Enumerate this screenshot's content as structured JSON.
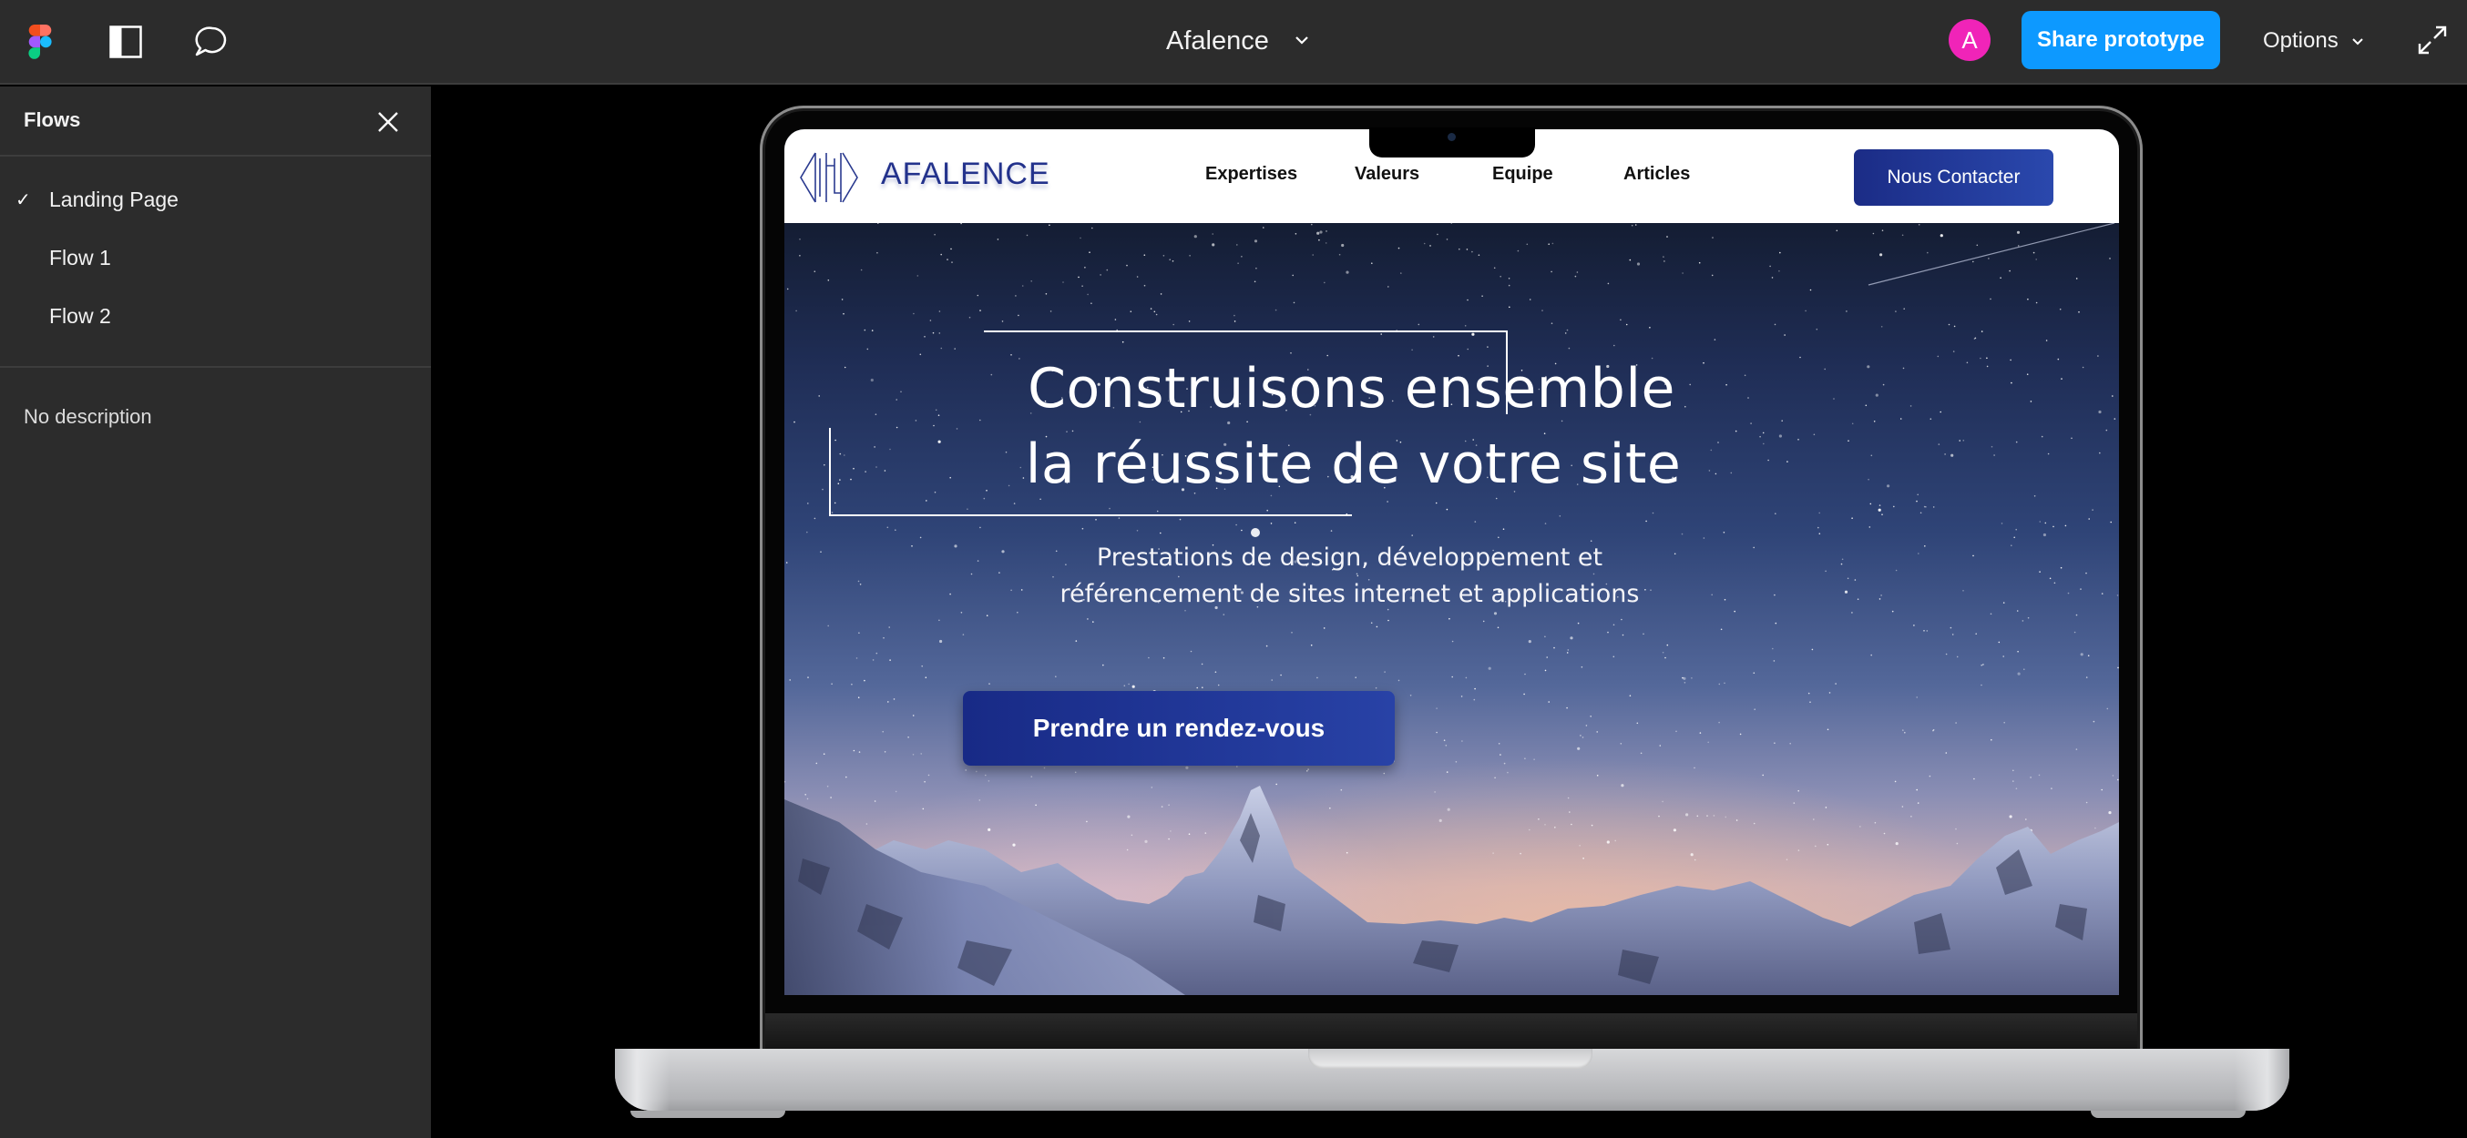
{
  "topbar": {
    "file_title": "Afalence",
    "avatar_initial": "A",
    "share_label": "Share prototype",
    "options_label": "Options",
    "colors": {
      "background": "#2c2c2c",
      "share": "#0d99ff",
      "avatar": "#f024b8"
    }
  },
  "sidebar": {
    "title": "Flows",
    "flows": [
      {
        "label": "Landing Page",
        "selected": true
      },
      {
        "label": "Flow 1",
        "selected": false
      },
      {
        "label": "Flow 2",
        "selected": false
      }
    ],
    "description": "No description"
  },
  "site": {
    "brand": "AFALENCE",
    "nav": [
      "Expertises",
      "Valeurs",
      "Equipe",
      "Articles"
    ],
    "contact_label": "Nous Contacter",
    "hero": {
      "title_line1": "Construisons ensemble",
      "title_line2": "la réussite de votre site",
      "subtitle_line1": "Prestations de design, développement et",
      "subtitle_line2": "référencement de sites internet et applications",
      "cta_label": "Prendre un rendez-vous"
    },
    "colors": {
      "brand": "#23328c",
      "button": "#1e33a0"
    }
  },
  "icons": {
    "check": "✓",
    "chevron_down": "⌄"
  }
}
